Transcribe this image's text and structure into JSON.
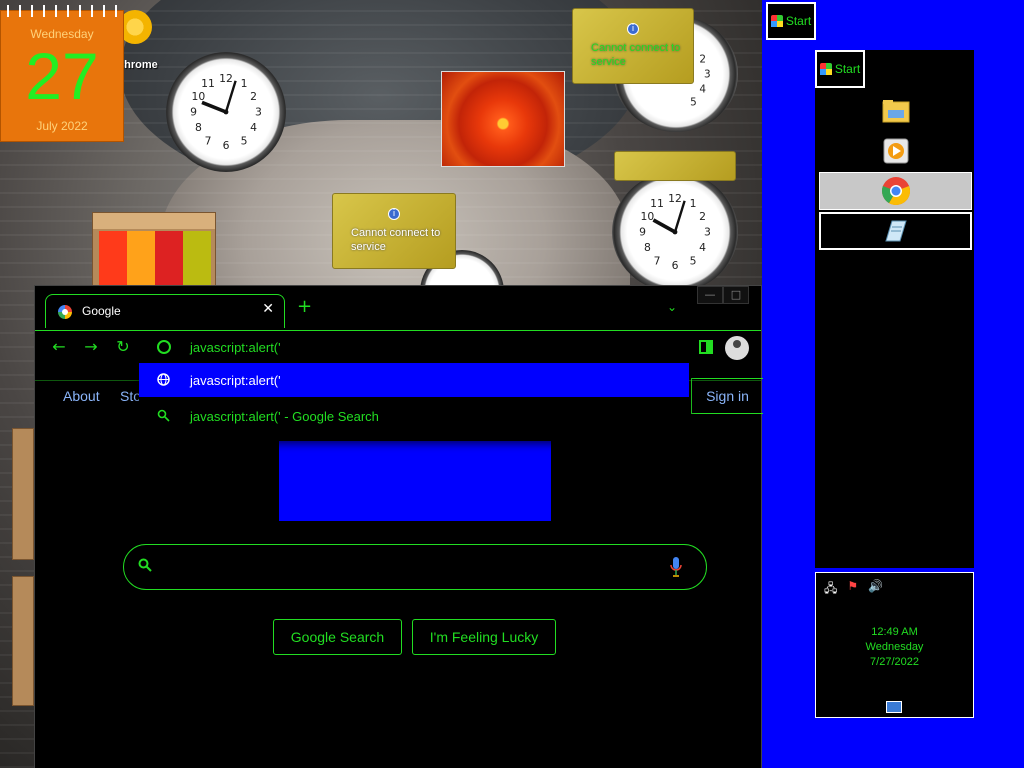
{
  "desktop": {
    "calendar": {
      "day_of_week": "Wednesday",
      "day": "27",
      "month_year": "July 2022"
    },
    "chrome_shortcut_label": "chrome",
    "weather_gadgets": [
      {
        "message": "Cannot connect to service"
      },
      {
        "message": "Cannot connect to service"
      }
    ]
  },
  "taskbar": {
    "start_label": "Start",
    "panel_start_label": "Start",
    "buttons": [
      {
        "name": "file-explorer",
        "icon": "folder-icon"
      },
      {
        "name": "media-player",
        "icon": "media-player-icon"
      },
      {
        "name": "chrome",
        "icon": "chrome-icon",
        "active": true
      },
      {
        "name": "notepad",
        "icon": "notepad-icon"
      }
    ],
    "tray": {
      "time": "12:49 AM",
      "day": "Wednesday",
      "date": "7/27/2022"
    }
  },
  "browser": {
    "tab_title": "Google",
    "omnibox_text": "javascript:alert('",
    "suggestions": [
      {
        "text": "javascript:alert('",
        "icon": "globe-icon",
        "selected": true
      },
      {
        "text": "javascript:alert(' - Google Search",
        "icon": "search-icon",
        "selected": false
      }
    ],
    "page": {
      "nav_about": "About",
      "nav_store": "Sto",
      "sign_in": "Sign in",
      "search_button": "Google Search",
      "lucky_button": "I'm Feeling Lucky"
    },
    "colors": {
      "accent": "#22dd22",
      "selection": "#0000ff",
      "link": "#8ab4f8"
    }
  }
}
